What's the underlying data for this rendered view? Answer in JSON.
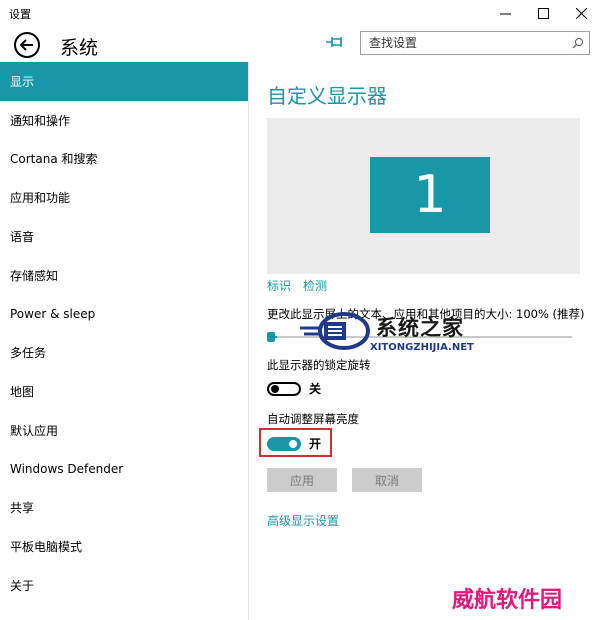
{
  "window": {
    "title": "设置"
  },
  "header": {
    "section_title": "系统",
    "search_placeholder": "查找设置"
  },
  "sidebar": {
    "items": [
      {
        "label": "显示",
        "active": true
      },
      {
        "label": "通知和操作"
      },
      {
        "label": "Cortana 和搜索"
      },
      {
        "label": "应用和功能"
      },
      {
        "label": "语音"
      },
      {
        "label": "存储感知"
      },
      {
        "label": "Power & sleep"
      },
      {
        "label": "多任务"
      },
      {
        "label": "地图"
      },
      {
        "label": "默认应用"
      },
      {
        "label": "Windows Defender"
      },
      {
        "label": "共享"
      },
      {
        "label": "平板电脑模式"
      },
      {
        "label": "关于"
      }
    ]
  },
  "main": {
    "title": "自定义显示器",
    "monitor_number": "1",
    "identify_link": "标识",
    "detect_link": "检测",
    "scale_label": "更改此显示屏上的文本、应用和其他项目的大小: 100% (推荐)",
    "scale_value_percent": 100,
    "rotation_lock_label": "此显示器的锁定旋转",
    "rotation_lock_state": "关",
    "auto_brightness_label": "自动调整屏幕亮度",
    "auto_brightness_state": "开",
    "apply_button": "应用",
    "cancel_button": "取消",
    "advanced_link": "高级显示设置"
  },
  "watermarks": {
    "logo_text": "系统之家",
    "logo_url_text": "XITONGZHIJIA.NET",
    "bottom_text": "威航软件园"
  },
  "colors": {
    "accent": "#1797a8",
    "highlight_border": "#d32f2f",
    "watermark_pink": "#e0197d"
  }
}
